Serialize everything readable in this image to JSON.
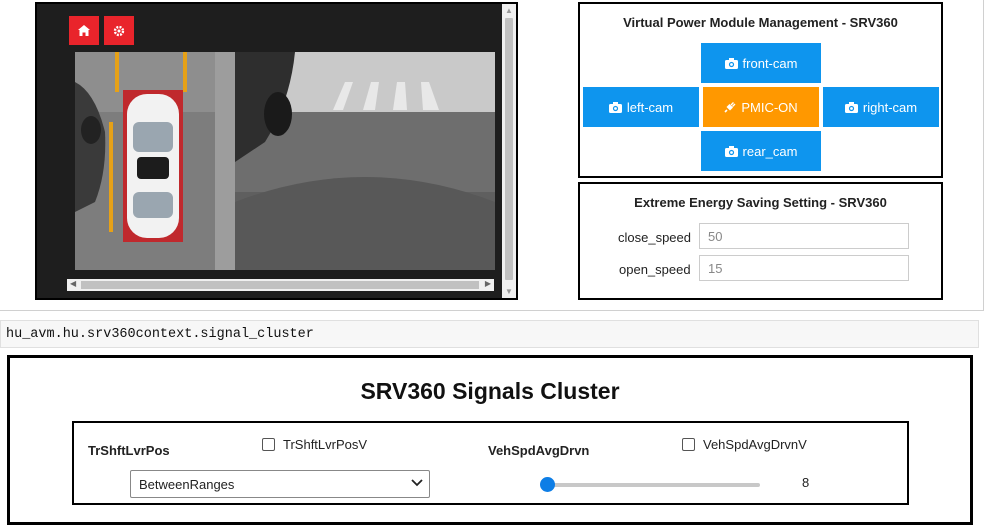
{
  "viewer": {
    "home_icon": "home-icon",
    "settings_icon": "gear-icon"
  },
  "management": {
    "title": "Virtual Power Module Management - SRV360",
    "buttons": {
      "front": "front-cam",
      "left": "left-cam",
      "pmic": "PMIC-ON",
      "right": "right-cam",
      "rear": "rear_cam"
    },
    "colors": {
      "blue": "#0e95ee",
      "orange": "#ff9800"
    }
  },
  "energy": {
    "title": "Extreme Energy Saving Setting - SRV360",
    "close_label": "close_speed",
    "close_value": "50",
    "open_label": "open_speed",
    "open_value": "15"
  },
  "code_cell": "hu_avm.hu.srv360context.signal_cluster",
  "cluster": {
    "title": "SRV360 Signals Cluster",
    "shift_label": "TrShftLvrPos",
    "shift_valid_label": "TrShftLvrPosV",
    "shift_selected": "BetweenRanges",
    "speed_label": "VehSpdAvgDrvn",
    "speed_valid_label": "VehSpdAvgDrvnV",
    "speed_value": "8"
  }
}
